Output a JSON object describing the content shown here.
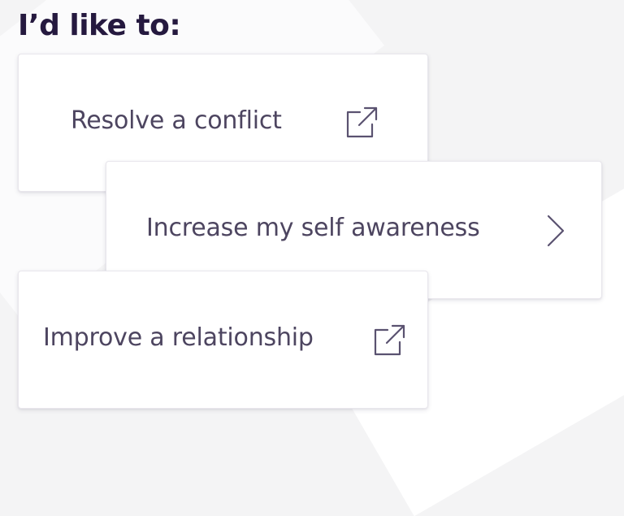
{
  "heading": "I’d like to:",
  "options": [
    {
      "label": "Resolve a conflict",
      "icon": "external-link-icon"
    },
    {
      "label": "Increase my self awareness",
      "icon": "chevron-right-icon"
    },
    {
      "label": "Improve a relationship",
      "icon": "external-link-icon"
    }
  ],
  "colors": {
    "heading": "#25193f",
    "label": "#4d4560",
    "icon": "#5a5270",
    "card_background": "#ffffff",
    "page_background": "#f4f4f5"
  }
}
